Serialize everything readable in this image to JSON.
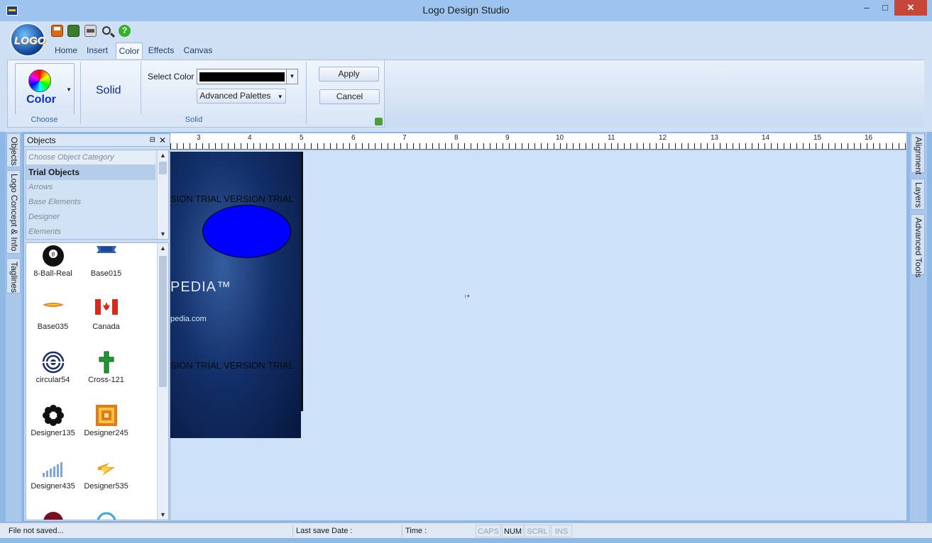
{
  "window": {
    "title": "Logo Design Studio",
    "min": "–",
    "max": "□",
    "close": "✕"
  },
  "app": {
    "orb_text": "LOGO"
  },
  "quick_access": [
    "save-icon",
    "save-as-icon",
    "print-icon",
    "print-preview-icon",
    "help-icon"
  ],
  "quick_help_glyph": "?",
  "tabs": [
    {
      "label": "Home"
    },
    {
      "label": "Insert"
    },
    {
      "label": "Color"
    },
    {
      "label": "Effects"
    },
    {
      "label": "Canvas"
    }
  ],
  "active_tab": "Color",
  "ribbon": {
    "choose_group": {
      "button_label": "Color",
      "group_label": "Choose"
    },
    "solid_group": {
      "mode_label": "Solid",
      "select_color_label": "Select Color",
      "selected_color": "#000000",
      "advanced_palettes_label": "Advanced Palettes",
      "group_label": "Solid"
    },
    "apply_label": "Apply",
    "cancel_label": "Cancel"
  },
  "left_vtabs": [
    {
      "label": "Objects"
    },
    {
      "label": "Logo Concept & Info"
    },
    {
      "label": "Taglines"
    }
  ],
  "right_vtabs": [
    {
      "label": "Alignment"
    },
    {
      "label": "Layers"
    },
    {
      "label": "Advanced Tools"
    }
  ],
  "objects_panel": {
    "title": "Objects",
    "category_placeholder": "Choose Object Category",
    "categories": [
      "Trial Objects",
      "Arrows",
      "Base Elements",
      "Designer",
      "Elements"
    ],
    "selected_category": "Trial Objects",
    "items": [
      {
        "name": "8-Ball-Real",
        "icon": "8-ball-icon"
      },
      {
        "name": "Base015",
        "icon": "ribbon-banner-icon"
      },
      {
        "name": "Base035",
        "icon": "flame-swoosh-icon"
      },
      {
        "name": "Canada",
        "icon": "canada-flag-icon"
      },
      {
        "name": "circular54",
        "icon": "concentric-rings-icon"
      },
      {
        "name": "Cross-121",
        "icon": "cross-icon"
      },
      {
        "name": "Designer135",
        "icon": "flower-icon"
      },
      {
        "name": "Designer245",
        "icon": "nested-squares-icon"
      },
      {
        "name": "Designer435",
        "icon": "bar-signal-icon"
      },
      {
        "name": "Designer535",
        "icon": "lightning-swoosh-icon"
      }
    ]
  },
  "ruler": {
    "numbers": [
      "3",
      "4",
      "5",
      "6",
      "7",
      "8",
      "9",
      "10",
      "11",
      "12",
      "13",
      "14",
      "15",
      "16"
    ]
  },
  "canvas": {
    "watermark_text": "TRIAL VERSION",
    "trial_line": "SION   TRIAL VERSION   TRIAL",
    "brand_fragment": "PEDIA™",
    "url_fragment": "pedia.com",
    "ellipse_color": "#0000ff",
    "cursor_mark": "↕≡"
  },
  "status": {
    "file": "File not saved...",
    "last_save": "Last save Date :",
    "time": "Time :",
    "keys": [
      {
        "label": "CAPS",
        "on": false
      },
      {
        "label": "NUM",
        "on": true
      },
      {
        "label": "SCRL",
        "on": false
      },
      {
        "label": "INS",
        "on": false
      }
    ]
  },
  "colors": {
    "accent": "#0d2fc7",
    "close_button": "#c7463a",
    "canvas_bg": "#cde1f8"
  }
}
